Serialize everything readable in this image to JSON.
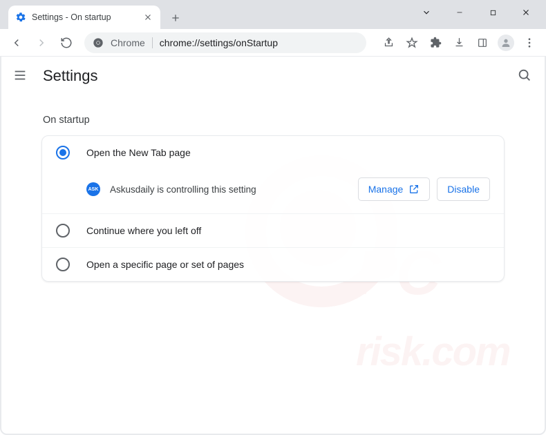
{
  "window": {
    "tab_title": "Settings - On startup"
  },
  "omnibox": {
    "origin_label": "Chrome",
    "path": "chrome://settings/onStartup"
  },
  "settings": {
    "header": "Settings",
    "section_title": "On startup",
    "options": [
      {
        "label": "Open the New Tab page",
        "selected": true
      },
      {
        "label": "Continue where you left off",
        "selected": false
      },
      {
        "label": "Open a specific page or set of pages",
        "selected": false
      }
    ],
    "extension": {
      "name_badge": "ASK",
      "message": "Askusdaily is controlling this setting",
      "manage_label": "Manage",
      "disable_label": "Disable"
    }
  }
}
